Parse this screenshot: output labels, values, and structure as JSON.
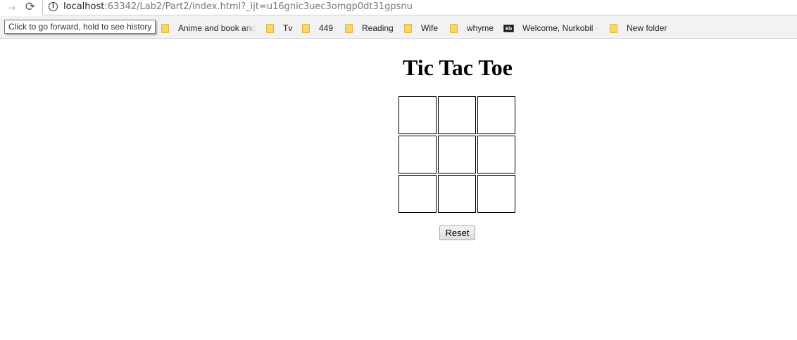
{
  "browser": {
    "url_host": "localhost",
    "url_rest": ":63342/Lab2/Part2/index.html?_ijt=u16gnic3uec3omgp0dt31gpsnu",
    "forward_glyph": "→",
    "reload_glyph": "⟳",
    "info_glyph": "i",
    "tooltip": "Click to go forward, hold to see history",
    "bookmarks": [
      {
        "label": "Anime and book and",
        "icon": "folder-icon"
      },
      {
        "label": "Tv",
        "icon": "folder-icon"
      },
      {
        "label": "449",
        "icon": "folder-icon"
      },
      {
        "label": "Reading",
        "icon": "folder-icon"
      },
      {
        "label": "Wife",
        "icon": "folder-icon"
      },
      {
        "label": "whyme",
        "icon": "folder-icon"
      },
      {
        "label": "Welcome, Nurkobil",
        "icon": "blackboard-icon",
        "icon_text": "Bb"
      },
      {
        "label": "New folder",
        "icon": "folder-icon"
      }
    ]
  },
  "game": {
    "title": "Tic Tac Toe",
    "cells": [
      "",
      "",
      "",
      "",
      "",
      "",
      "",
      "",
      ""
    ],
    "reset_label": "Reset"
  }
}
